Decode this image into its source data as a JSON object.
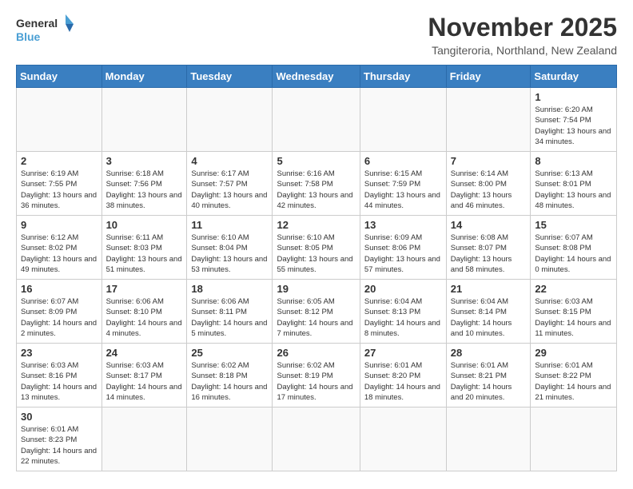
{
  "logo": {
    "general": "General",
    "blue": "Blue"
  },
  "header": {
    "title": "November 2025",
    "subtitle": "Tangiteroria, Northland, New Zealand"
  },
  "weekdays": [
    "Sunday",
    "Monday",
    "Tuesday",
    "Wednesday",
    "Thursday",
    "Friday",
    "Saturday"
  ],
  "weeks": [
    [
      null,
      null,
      null,
      null,
      null,
      null,
      {
        "day": "1",
        "sunrise": "6:20 AM",
        "sunset": "7:54 PM",
        "daylight": "13 hours and 34 minutes."
      }
    ],
    [
      {
        "day": "2",
        "sunrise": "6:19 AM",
        "sunset": "7:55 PM",
        "daylight": "13 hours and 36 minutes."
      },
      {
        "day": "3",
        "sunrise": "6:18 AM",
        "sunset": "7:56 PM",
        "daylight": "13 hours and 38 minutes."
      },
      {
        "day": "4",
        "sunrise": "6:17 AM",
        "sunset": "7:57 PM",
        "daylight": "13 hours and 40 minutes."
      },
      {
        "day": "5",
        "sunrise": "6:16 AM",
        "sunset": "7:58 PM",
        "daylight": "13 hours and 42 minutes."
      },
      {
        "day": "6",
        "sunrise": "6:15 AM",
        "sunset": "7:59 PM",
        "daylight": "13 hours and 44 minutes."
      },
      {
        "day": "7",
        "sunrise": "6:14 AM",
        "sunset": "8:00 PM",
        "daylight": "13 hours and 46 minutes."
      },
      {
        "day": "8",
        "sunrise": "6:13 AM",
        "sunset": "8:01 PM",
        "daylight": "13 hours and 48 minutes."
      }
    ],
    [
      {
        "day": "9",
        "sunrise": "6:12 AM",
        "sunset": "8:02 PM",
        "daylight": "13 hours and 49 minutes."
      },
      {
        "day": "10",
        "sunrise": "6:11 AM",
        "sunset": "8:03 PM",
        "daylight": "13 hours and 51 minutes."
      },
      {
        "day": "11",
        "sunrise": "6:10 AM",
        "sunset": "8:04 PM",
        "daylight": "13 hours and 53 minutes."
      },
      {
        "day": "12",
        "sunrise": "6:10 AM",
        "sunset": "8:05 PM",
        "daylight": "13 hours and 55 minutes."
      },
      {
        "day": "13",
        "sunrise": "6:09 AM",
        "sunset": "8:06 PM",
        "daylight": "13 hours and 57 minutes."
      },
      {
        "day": "14",
        "sunrise": "6:08 AM",
        "sunset": "8:07 PM",
        "daylight": "13 hours and 58 minutes."
      },
      {
        "day": "15",
        "sunrise": "6:07 AM",
        "sunset": "8:08 PM",
        "daylight": "14 hours and 0 minutes."
      }
    ],
    [
      {
        "day": "16",
        "sunrise": "6:07 AM",
        "sunset": "8:09 PM",
        "daylight": "14 hours and 2 minutes."
      },
      {
        "day": "17",
        "sunrise": "6:06 AM",
        "sunset": "8:10 PM",
        "daylight": "14 hours and 4 minutes."
      },
      {
        "day": "18",
        "sunrise": "6:06 AM",
        "sunset": "8:11 PM",
        "daylight": "14 hours and 5 minutes."
      },
      {
        "day": "19",
        "sunrise": "6:05 AM",
        "sunset": "8:12 PM",
        "daylight": "14 hours and 7 minutes."
      },
      {
        "day": "20",
        "sunrise": "6:04 AM",
        "sunset": "8:13 PM",
        "daylight": "14 hours and 8 minutes."
      },
      {
        "day": "21",
        "sunrise": "6:04 AM",
        "sunset": "8:14 PM",
        "daylight": "14 hours and 10 minutes."
      },
      {
        "day": "22",
        "sunrise": "6:03 AM",
        "sunset": "8:15 PM",
        "daylight": "14 hours and 11 minutes."
      }
    ],
    [
      {
        "day": "23",
        "sunrise": "6:03 AM",
        "sunset": "8:16 PM",
        "daylight": "14 hours and 13 minutes."
      },
      {
        "day": "24",
        "sunrise": "6:03 AM",
        "sunset": "8:17 PM",
        "daylight": "14 hours and 14 minutes."
      },
      {
        "day": "25",
        "sunrise": "6:02 AM",
        "sunset": "8:18 PM",
        "daylight": "14 hours and 16 minutes."
      },
      {
        "day": "26",
        "sunrise": "6:02 AM",
        "sunset": "8:19 PM",
        "daylight": "14 hours and 17 minutes."
      },
      {
        "day": "27",
        "sunrise": "6:01 AM",
        "sunset": "8:20 PM",
        "daylight": "14 hours and 18 minutes."
      },
      {
        "day": "28",
        "sunrise": "6:01 AM",
        "sunset": "8:21 PM",
        "daylight": "14 hours and 20 minutes."
      },
      {
        "day": "29",
        "sunrise": "6:01 AM",
        "sunset": "8:22 PM",
        "daylight": "14 hours and 21 minutes."
      }
    ],
    [
      {
        "day": "30",
        "sunrise": "6:01 AM",
        "sunset": "8:23 PM",
        "daylight": "14 hours and 22 minutes."
      },
      null,
      null,
      null,
      null,
      null,
      null
    ]
  ]
}
